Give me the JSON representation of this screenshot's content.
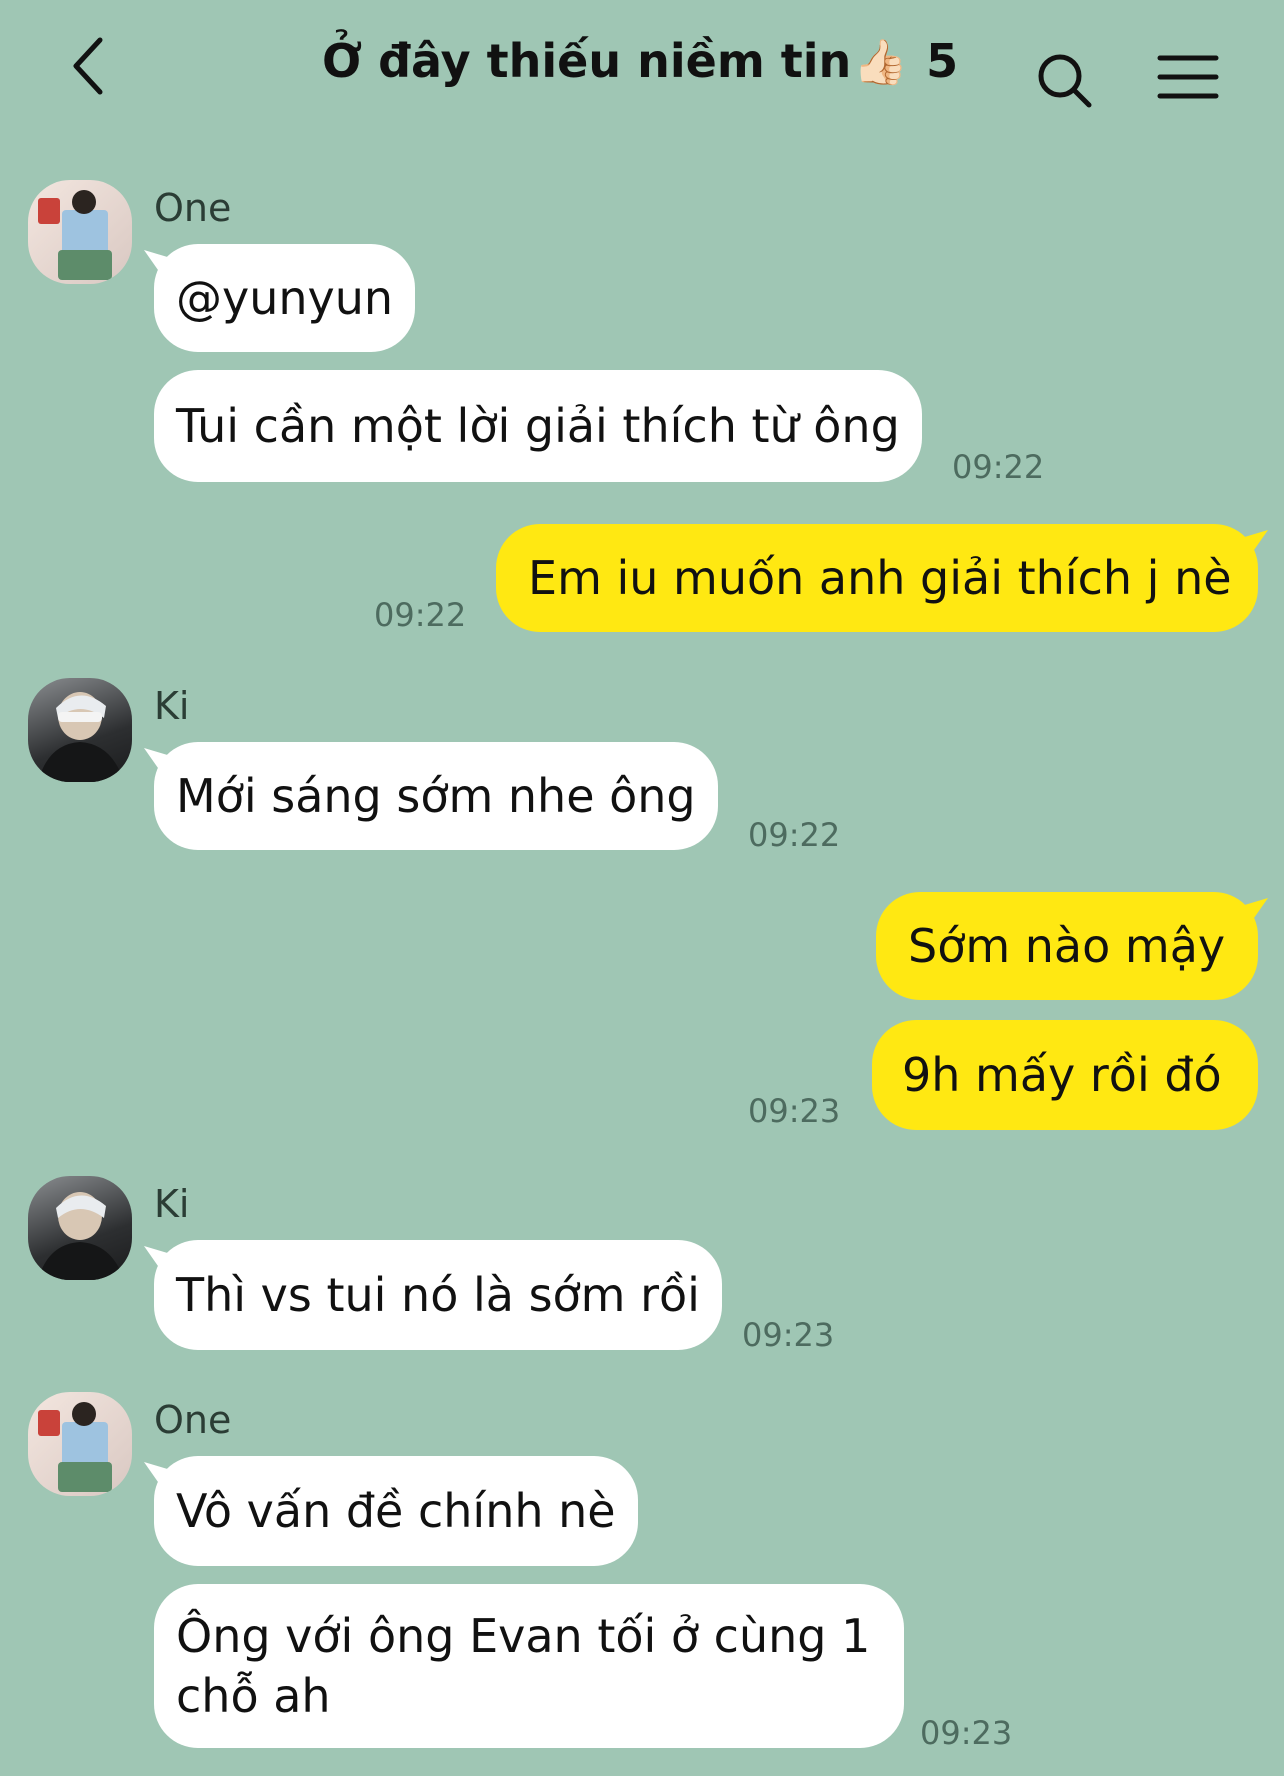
{
  "header": {
    "back_icon": "chevron-left-icon",
    "title": "Ở đây thiếu niềm tin",
    "title_emoji": "👍🏻",
    "member_count": "5",
    "search_icon": "search-icon",
    "menu_icon": "menu-icon"
  },
  "colors": {
    "background": "#9fc6b4",
    "incoming_bubble": "#ffffff",
    "outgoing_bubble": "#ffe812"
  },
  "messages": [
    {
      "sender": "One",
      "text": "@yunyun",
      "direction": "incoming"
    },
    {
      "text": "Tui cần một lời giải thích từ ông",
      "time": "09:22",
      "direction": "incoming"
    },
    {
      "text": "Em iu muốn anh giải thích j nè",
      "time": "09:22",
      "direction": "outgoing"
    },
    {
      "sender": "Ki",
      "text": "Mới sáng sớm nhe ông",
      "time": "09:22",
      "direction": "incoming"
    },
    {
      "text": "Sớm nào mậy",
      "direction": "outgoing"
    },
    {
      "text": "9h mấy rồi đó",
      "time": "09:23",
      "direction": "outgoing"
    },
    {
      "sender": "Ki",
      "text": "Thì vs tui nó là sớm rồi",
      "time": "09:23",
      "direction": "incoming"
    },
    {
      "sender": "One",
      "text": "Vô vấn đề chính nè",
      "direction": "incoming"
    },
    {
      "text": "Ông với ông Evan tối ở cùng 1 chỗ ah",
      "time": "09:23",
      "direction": "incoming"
    }
  ]
}
